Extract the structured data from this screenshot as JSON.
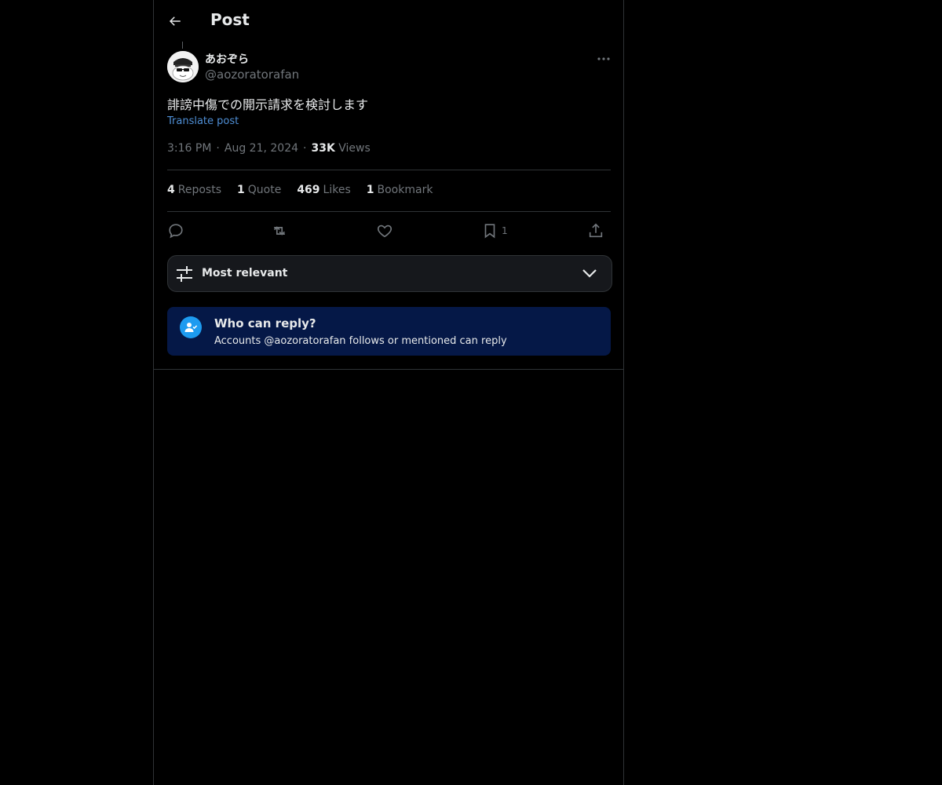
{
  "header": {
    "title": "Post"
  },
  "post": {
    "display_name": "あおぞら",
    "handle": "@aozoratorafan",
    "text": "誹謗中傷での開示請求を検討します",
    "translate_label": "Translate post",
    "time": "3:16 PM",
    "date": "Aug 21, 2024",
    "views_count": "33K",
    "views_label": "Views"
  },
  "stats": {
    "reposts_count": "4",
    "reposts_label": "Reposts",
    "quotes_count": "1",
    "quotes_label": "Quote",
    "likes_count": "469",
    "likes_label": "Likes",
    "bookmarks_count": "1",
    "bookmarks_label": "Bookmark"
  },
  "actions": {
    "bookmark_count": "1"
  },
  "sort": {
    "label": "Most relevant"
  },
  "reply_notice": {
    "title": "Who can reply?",
    "subtitle": "Accounts @aozoratorafan follows or mentioned can reply"
  },
  "colors": {
    "accent": "#1d9bf0",
    "link": "#4f8fd6",
    "notice_bg": "#051847"
  }
}
